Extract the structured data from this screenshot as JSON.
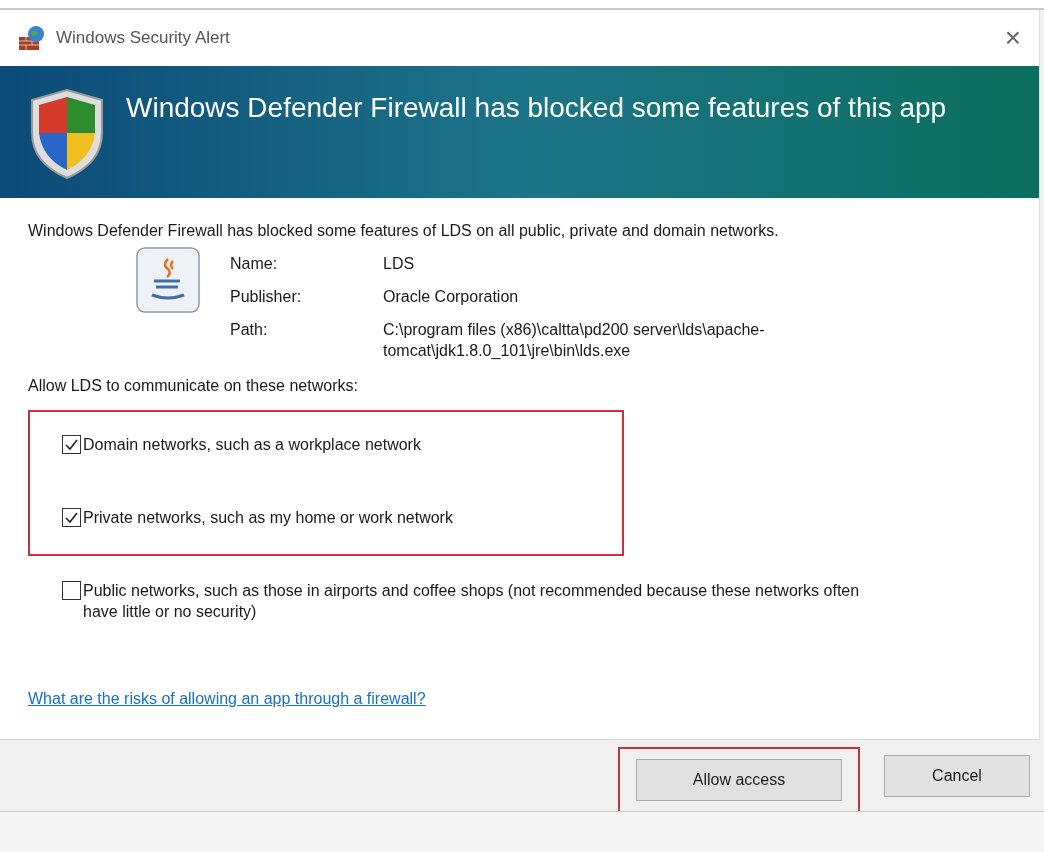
{
  "window": {
    "title": "Windows Security Alert",
    "close": "×"
  },
  "banner": {
    "heading": "Windows Defender Firewall has blocked some features of this app"
  },
  "message": "Windows Defender Firewall has blocked some features of LDS on all public, private and domain networks.",
  "details": [
    {
      "label": "Name:",
      "value": "LDS"
    },
    {
      "label": "Publisher:",
      "value": "Oracle Corporation"
    },
    {
      "label": "Path:",
      "value": "C:\\program files (x86)\\caltta\\pd200 server\\lds\\apache-tomcat\\jdk1.8.0_101\\jre\\bin\\lds.exe"
    }
  ],
  "networks_prompt": "Allow LDS to communicate on these networks:",
  "networks": [
    {
      "label": "Domain networks, such as a workplace network",
      "checked": true,
      "highlighted": true
    },
    {
      "label": "Private networks, such as my home or work network",
      "checked": true,
      "highlighted": true
    },
    {
      "label": "Public networks, such as those in airports and coffee shops (not recommended because these networks often have little or no security)",
      "checked": false,
      "highlighted": false
    }
  ],
  "link": "What are the risks of allowing an app through a firewall?",
  "buttons": [
    {
      "label": "Allow access",
      "highlighted": true
    },
    {
      "label": "Cancel",
      "highlighted": false
    }
  ]
}
